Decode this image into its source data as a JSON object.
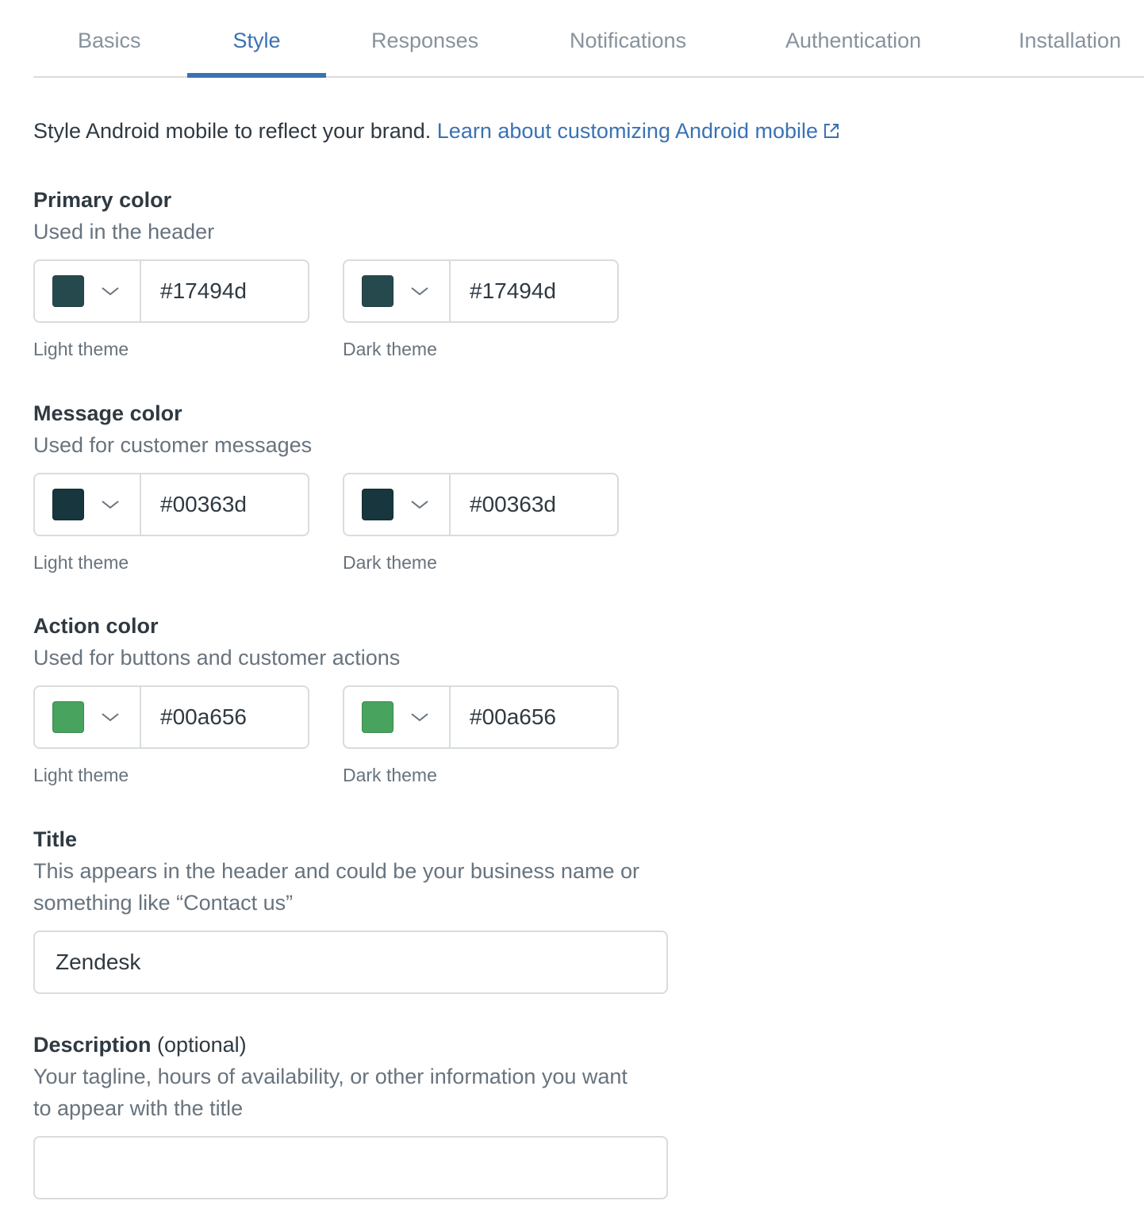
{
  "tabs": [
    {
      "label": "Basics",
      "active": false
    },
    {
      "label": "Style",
      "active": true
    },
    {
      "label": "Responses",
      "active": false
    },
    {
      "label": "Notifications",
      "active": false
    },
    {
      "label": "Authentication",
      "active": false
    },
    {
      "label": "Installation",
      "active": false
    }
  ],
  "intro": {
    "text": "Style Android mobile to reflect your brand. ",
    "link_label": "Learn about customizing Android mobile",
    "link_icon": "external-link-icon"
  },
  "colors": {
    "accent": "#3a72b3",
    "sections": [
      {
        "label": "Primary color",
        "hint": "Used in the header",
        "light": {
          "theme_label": "Light theme",
          "value": "#17494d",
          "swatch": "#26494d"
        },
        "dark": {
          "theme_label": "Dark theme",
          "value": "#17494d",
          "swatch": "#26494d"
        }
      },
      {
        "label": "Message color",
        "hint": "Used for customer messages",
        "light": {
          "theme_label": "Light theme",
          "value": "#00363d",
          "swatch": "#17363d"
        },
        "dark": {
          "theme_label": "Dark theme",
          "value": "#00363d",
          "swatch": "#17363d"
        }
      },
      {
        "label": "Action color",
        "hint": "Used for buttons and customer actions",
        "light": {
          "theme_label": "Light theme",
          "value": "#00a656",
          "swatch": "#47a35d"
        },
        "dark": {
          "theme_label": "Dark theme",
          "value": "#00a656",
          "swatch": "#47a35d"
        }
      }
    ]
  },
  "title_field": {
    "label": "Title",
    "hint_line1": "This appears in the header and could be your business name or",
    "hint_line2": "something like “Contact us”",
    "value": "Zendesk"
  },
  "description_field": {
    "label": "Description",
    "optional": "(optional)",
    "hint_line1": "Your tagline, hours of availability, or other information you want",
    "hint_line2": "to appear with the title",
    "value": ""
  }
}
